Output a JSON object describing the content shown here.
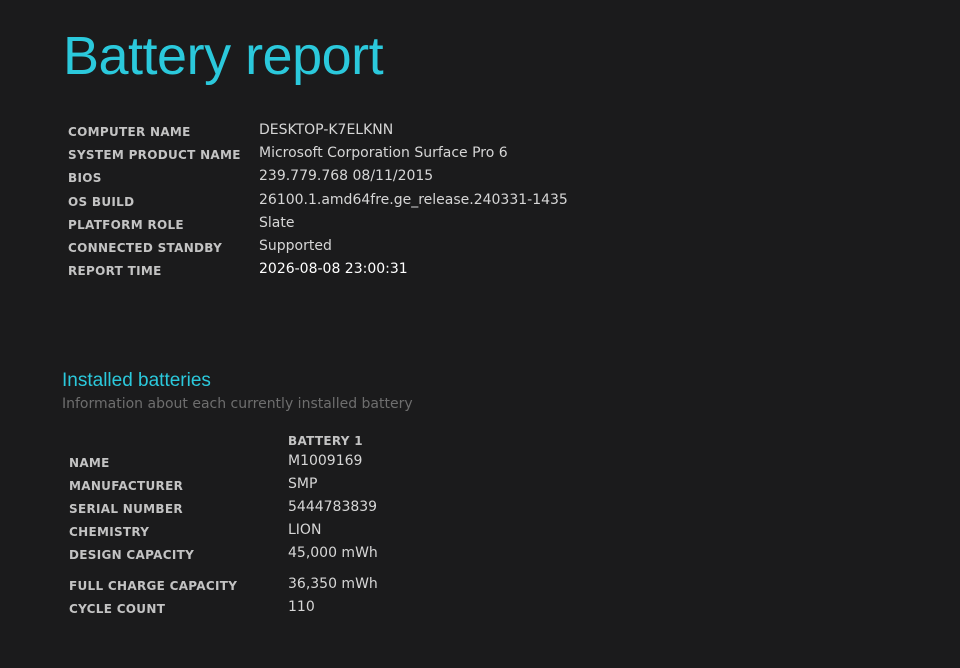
{
  "title": "Battery report",
  "system_info": [
    {
      "label": "COMPUTER NAME",
      "value": "DESKTOP-K7ELKNN"
    },
    {
      "label": "SYSTEM PRODUCT NAME",
      "value": "Microsoft Corporation Surface Pro 6"
    },
    {
      "label": "BIOS",
      "value": "239.779.768 08/11/2015"
    },
    {
      "label": "OS BUILD",
      "value": "26100.1.amd64fre.ge_release.240331-1435"
    },
    {
      "label": "PLATFORM ROLE",
      "value": "Slate"
    },
    {
      "label": "CONNECTED STANDBY",
      "value": "Supported"
    },
    {
      "label": "REPORT TIME",
      "value": "2026-08-08  23:00:31"
    }
  ],
  "installed_batteries": {
    "title": "Installed batteries",
    "subtitle": "Information about each currently installed battery",
    "column_header": "BATTERY 1",
    "rows": [
      {
        "label": "NAME",
        "value": "M1009169"
      },
      {
        "label": "MANUFACTURER",
        "value": "SMP"
      },
      {
        "label": "SERIAL NUMBER",
        "value": "5444783839"
      },
      {
        "label": "CHEMISTRY",
        "value": "LION"
      },
      {
        "label": "DESIGN CAPACITY",
        "value": "45,000 mWh"
      },
      {
        "label": "FULL CHARGE CAPACITY",
        "value": "36,350 mWh"
      },
      {
        "label": "CYCLE COUNT",
        "value": "110"
      }
    ]
  },
  "colors": {
    "background": "#1b1b1c",
    "accent": "#2bc9dc",
    "label": "#c3c3c3",
    "value": "#d6d6d6",
    "muted": "#6e6e6e"
  }
}
